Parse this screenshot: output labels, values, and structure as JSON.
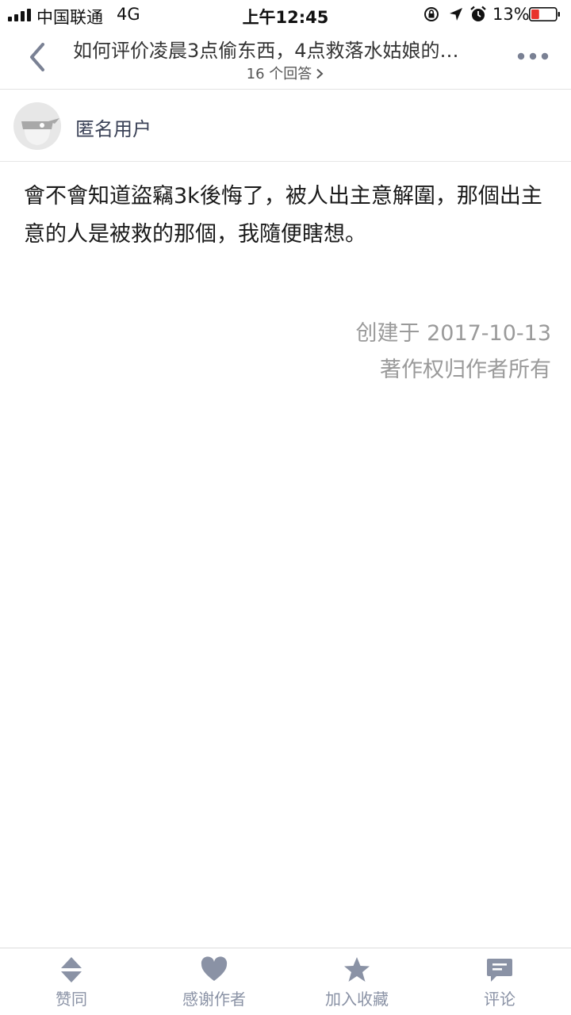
{
  "status_bar": {
    "carrier": "中国联通",
    "network": "4G",
    "time": "上午12:45",
    "battery": "13%",
    "battery_level": 0.13
  },
  "nav": {
    "question_title": "如何评价凌晨3点偷东西，4点救落水姑娘的…",
    "answers_count": "16 个回答"
  },
  "answer": {
    "author": "匿名用户",
    "content": "會不會知道盜竊3k後悔了，被人出主意解圍，那個出主意的人是被救的那個，我隨便瞎想。",
    "created": "创建于 2017-10-13",
    "copyright": "著作权归作者所有"
  },
  "tabs": [
    {
      "label": "赞同",
      "icon": "vote-icon"
    },
    {
      "label": "感谢作者",
      "icon": "heart-icon"
    },
    {
      "label": "加入收藏",
      "icon": "star-icon"
    },
    {
      "label": "评论",
      "icon": "comment-icon"
    }
  ],
  "colors": {
    "tab_icon": "#8a92a5",
    "meta_text": "#9a9a9a",
    "author_name": "#3b4257",
    "battery_low": "#e8322b"
  }
}
